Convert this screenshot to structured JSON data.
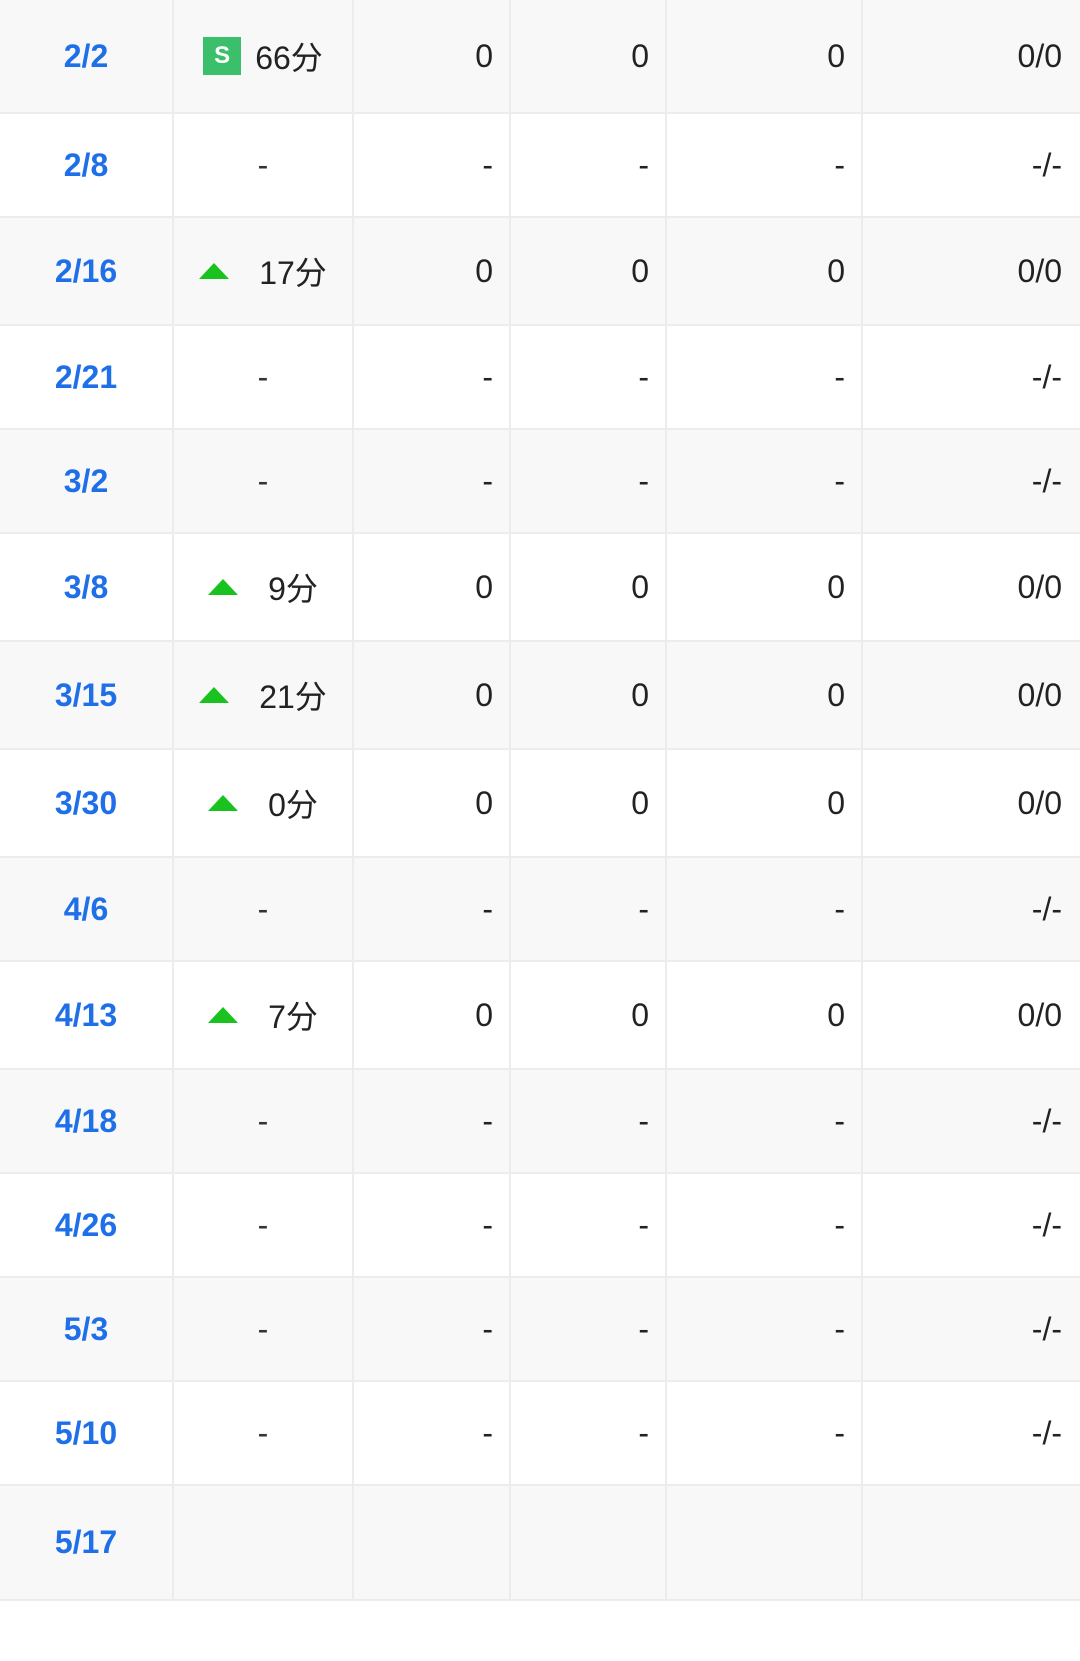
{
  "table": {
    "rows": [
      {
        "date": "2/2",
        "badge": "S",
        "arrow": false,
        "minutes": "66分",
        "a": "0",
        "b": "0",
        "c": "0",
        "d": "0/0"
      },
      {
        "date": "2/8",
        "badge": "",
        "arrow": false,
        "minutes": "-",
        "a": "-",
        "b": "-",
        "c": "-",
        "d": "-/-"
      },
      {
        "date": "2/16",
        "badge": "",
        "arrow": true,
        "minutes": "17分",
        "a": "0",
        "b": "0",
        "c": "0",
        "d": "0/0"
      },
      {
        "date": "2/21",
        "badge": "",
        "arrow": false,
        "minutes": "-",
        "a": "-",
        "b": "-",
        "c": "-",
        "d": "-/-"
      },
      {
        "date": "3/2",
        "badge": "",
        "arrow": false,
        "minutes": "-",
        "a": "-",
        "b": "-",
        "c": "-",
        "d": "-/-"
      },
      {
        "date": "3/8",
        "badge": "",
        "arrow": true,
        "minutes": "9分",
        "a": "0",
        "b": "0",
        "c": "0",
        "d": "0/0"
      },
      {
        "date": "3/15",
        "badge": "",
        "arrow": true,
        "minutes": "21分",
        "a": "0",
        "b": "0",
        "c": "0",
        "d": "0/0"
      },
      {
        "date": "3/30",
        "badge": "",
        "arrow": true,
        "minutes": "0分",
        "a": "0",
        "b": "0",
        "c": "0",
        "d": "0/0"
      },
      {
        "date": "4/6",
        "badge": "",
        "arrow": false,
        "minutes": "-",
        "a": "-",
        "b": "-",
        "c": "-",
        "d": "-/-"
      },
      {
        "date": "4/13",
        "badge": "",
        "arrow": true,
        "minutes": "7分",
        "a": "0",
        "b": "0",
        "c": "0",
        "d": "0/0"
      },
      {
        "date": "4/18",
        "badge": "",
        "arrow": false,
        "minutes": "-",
        "a": "-",
        "b": "-",
        "c": "-",
        "d": "-/-"
      },
      {
        "date": "4/26",
        "badge": "",
        "arrow": false,
        "minutes": "-",
        "a": "-",
        "b": "-",
        "c": "-",
        "d": "-/-"
      },
      {
        "date": "5/3",
        "badge": "",
        "arrow": false,
        "minutes": "-",
        "a": "-",
        "b": "-",
        "c": "-",
        "d": "-/-"
      },
      {
        "date": "5/10",
        "badge": "",
        "arrow": false,
        "minutes": "-",
        "a": "-",
        "b": "-",
        "c": "-",
        "d": "-/-"
      },
      {
        "date": "5/17",
        "badge": "",
        "arrow": false,
        "minutes": "",
        "a": "",
        "b": "",
        "c": "",
        "d": ""
      }
    ]
  },
  "colors": {
    "date_link": "#1e6fe8",
    "start_badge": "#3cbf6a",
    "up_arrow": "#19c21f"
  },
  "icons": {
    "start_badge": "starter-badge-icon",
    "arrow": "arrow-up-icon"
  }
}
